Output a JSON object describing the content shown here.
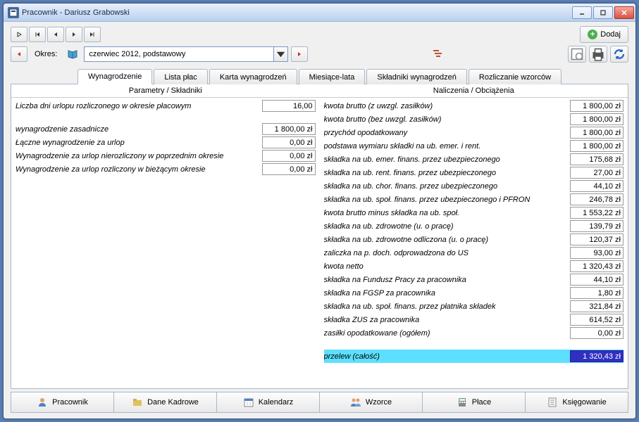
{
  "title": "Pracownik - Dariusz Grabowski",
  "toolbar": {
    "dodaj_label": "Dodaj",
    "okres_label": "Okres:",
    "period_value": "czerwiec 2012, podstawowy"
  },
  "tabs": [
    {
      "label": "Wynagrodzenie",
      "active": true
    },
    {
      "label": "Lista płac"
    },
    {
      "label": "Karta wynagrodzeń"
    },
    {
      "label": "Miesiące-lata"
    },
    {
      "label": "Składniki wynagrodzeń"
    },
    {
      "label": "Rozliczanie wzorców"
    }
  ],
  "left": {
    "header": "Parametry / Składniki",
    "rows": [
      {
        "label": "Liczba dni urlopu rozliczonego w okresie płacowym",
        "value": "16,00"
      },
      {
        "gap": true
      },
      {
        "label": "wynagrodzenie zasadnicze",
        "value": "1 800,00 zł"
      },
      {
        "label": "Łączne wynagrodzenie za urlop",
        "value": "0,00 zł"
      },
      {
        "label": "Wynagrodzenie za urlop nierozliczony w poprzednim okresie",
        "value": "0,00 zł"
      },
      {
        "label": "Wynagrodzenie za urlop rozliczony w bieżącym okresie",
        "value": "0,00 zł"
      }
    ]
  },
  "right": {
    "header": "Naliczenia / Obciążenia",
    "rows": [
      {
        "label": "kwota brutto (z uwzgl. zasiłków)",
        "value": "1 800,00 zł"
      },
      {
        "label": "kwota brutto (bez uwzgl. zasiłków)",
        "value": "1 800,00 zł"
      },
      {
        "label": "przychód opodatkowany",
        "value": "1 800,00 zł"
      },
      {
        "label": "podstawa wymiaru składki na ub. emer. i rent.",
        "value": "1 800,00 zł"
      },
      {
        "label": "składka na ub. emer. finans. przez ubezpieczonego",
        "value": "175,68 zł"
      },
      {
        "label": "składka na ub. rent. finans. przez ubezpieczonego",
        "value": "27,00 zł"
      },
      {
        "label": "składka na ub. chor. finans. przez ubezpieczonego",
        "value": "44,10 zł"
      },
      {
        "label": "składka na ub. społ. finans. przez ubezpieczonego i PFRON",
        "value": "246,78 zł"
      },
      {
        "label": "kwota brutto minus składka na ub. społ.",
        "value": "1 553,22 zł"
      },
      {
        "label": "składka na ub. zdrowotne (u. o pracę)",
        "value": "139,79 zł"
      },
      {
        "label": "składka na ub. zdrowotne odliczona (u. o pracę)",
        "value": "120,37 zł"
      },
      {
        "label": "zaliczka na p. doch. odprowadzona do US",
        "value": "93,00 zł"
      },
      {
        "label": "kwota netto",
        "value": "1 320,43 zł"
      },
      {
        "label": "składka na Fundusz Pracy za pracownika",
        "value": "44,10 zł"
      },
      {
        "label": "składka na FGŚP za pracownika",
        "value": "1,80 zł"
      },
      {
        "label": "składka na ub. społ. finans. przez płatnika składek",
        "value": "321,84 zł"
      },
      {
        "label": "składka ZUS za pracownika",
        "value": "614,52 zł"
      },
      {
        "label": "zasiłki opodatkowane (ogółem)",
        "value": "0,00 zł"
      },
      {
        "gap": true
      },
      {
        "label": "przelew (całość)",
        "value": "1 320,43 zł",
        "hl": true
      }
    ]
  },
  "bottom": [
    {
      "label": "Pracownik",
      "icon": "person"
    },
    {
      "label": "Dane Kadrowe",
      "icon": "folder"
    },
    {
      "label": "Kalendarz",
      "icon": "calendar"
    },
    {
      "label": "Wzorce",
      "icon": "people"
    },
    {
      "label": "Płace",
      "icon": "calc"
    },
    {
      "label": "Księgowanie",
      "icon": "doc"
    }
  ]
}
